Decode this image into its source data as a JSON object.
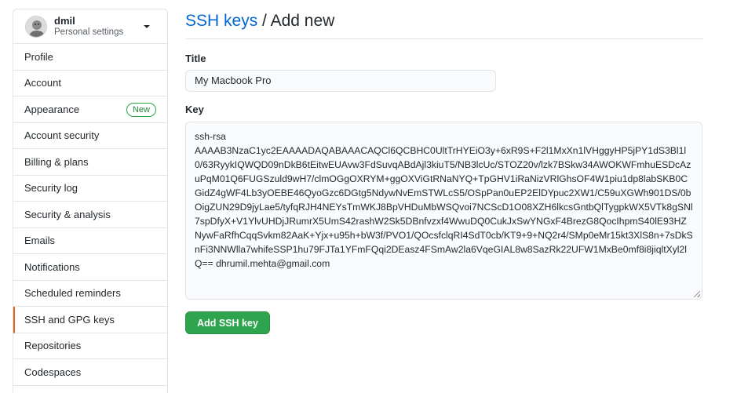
{
  "user": {
    "name": "dmil",
    "subtitle": "Personal settings"
  },
  "sidebar": {
    "items": [
      {
        "label": "Profile"
      },
      {
        "label": "Account"
      },
      {
        "label": "Appearance",
        "badge": "New"
      },
      {
        "label": "Account security"
      },
      {
        "label": "Billing & plans"
      },
      {
        "label": "Security log"
      },
      {
        "label": "Security & analysis"
      },
      {
        "label": "Emails"
      },
      {
        "label": "Notifications"
      },
      {
        "label": "Scheduled reminders"
      },
      {
        "label": "SSH and GPG keys",
        "selected": true
      },
      {
        "label": "Repositories"
      },
      {
        "label": "Codespaces"
      }
    ]
  },
  "header": {
    "breadcrumb": "SSH keys",
    "separator": " / ",
    "title": "Add new"
  },
  "form": {
    "title_label": "Title",
    "title_value": "My Macbook Pro",
    "key_label": "Key",
    "key_value": "ssh-rsa\nAAAAB3NzaC1yc2EAAAADAQABAAACAQCl6QCBHC0UltTrHYEiO3y+6xR9S+F2l1MxXn1lVHggyHP5jPY1dS3Bl1l0/63RyykIQWQD09nDkB6tEitwEUAvw3FdSuvqABdAjl3kiuT5/NB3lcUc/STOZ20v/lzk7BSkw34AWOKWFmhuESDcAzuPqM01Q6FUGSzuld9wH7/clmOGgOXRYM+ggOXViGtRNaNYQ+TpGHV1iRaNizVRlGhsOF4W1piu1dp8labSKB0CGidZ4gWF4Lb3yOEBE46QyoGzc6DGtg5NdywNvEmSTWLcS5/OSpPan0uEP2ElDYpuc2XW1/C59uXGWh901DS/0bOigZUN29D9jyLae5/tyfqRJH4NEYsTmWKJ8BpVHDuMbWSQvoi7NCScD1O08XZH6lkcsGntbQlTygpkWX5VTk8gSNl7spDfyX+V1YlvUHDjJRumrX5UmS42rashW2Sk5DBnfvzxf4WwuDQ0CukJxSwYNGxF4BrezG8QocIhpmS40lE93HZNywFaRfhCqqSvkm82AaK+Yjx+u95h+bW3f/PVO1/QOcsfclqRI4SdT0cb/KT9+9+NQ2r4/SMp0eMr15kt3XlS8n+7sDkSnFi3NNWlla7whifeSSP1hu79FJTa1YFmFQqi2DEasz4FSmAw2la6VqeGIAL8w8SazRk22UFW1MxBe0mf8i8jiqltXyl2lQ== dhrumil.mehta@gmail.com",
    "submit_label": "Add SSH key"
  },
  "colors": {
    "accent": "#0366d6",
    "selected_indicator": "#e36209",
    "button": "#2ea44f",
    "badge": "#28a745"
  }
}
